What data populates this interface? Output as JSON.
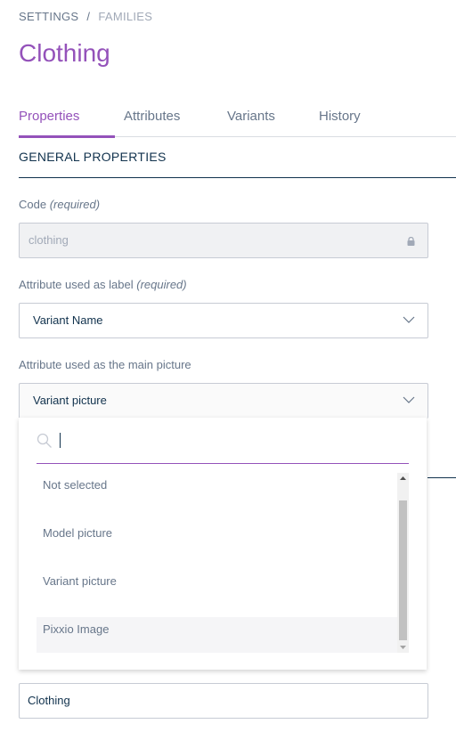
{
  "breadcrumb": {
    "settings": "SETTINGS",
    "separator": "/",
    "families": "FAMILIES"
  },
  "page": {
    "title": "Clothing"
  },
  "tabs": [
    {
      "label": "Properties",
      "active": true
    },
    {
      "label": "Attributes",
      "active": false
    },
    {
      "label": "Variants",
      "active": false
    },
    {
      "label": "History",
      "active": false
    }
  ],
  "section": {
    "title": "GENERAL PROPERTIES"
  },
  "fields": {
    "code": {
      "label": "Code",
      "required": "(required)",
      "value": "clothing",
      "icon": "lock-icon"
    },
    "label_attribute": {
      "label": "Attribute used as label",
      "required": "(required)",
      "value": "Variant Name",
      "icon": "chevron-down-icon"
    },
    "main_picture": {
      "label": "Attribute used as the main picture",
      "value": "Variant picture",
      "icon": "chevron-down-icon"
    },
    "bottom_field": {
      "value": "Clothing"
    }
  },
  "dropdown": {
    "search_value": "",
    "options": [
      "Not selected",
      "Model picture",
      "Variant picture",
      "Pixxio Image"
    ],
    "hovered_option": "Pixxio Image"
  },
  "colors": {
    "accent": "#9452ba",
    "text": "#11324d",
    "muted": "#67768a",
    "border": "#c7cbd4",
    "locked_bg": "#f0f1f3"
  }
}
